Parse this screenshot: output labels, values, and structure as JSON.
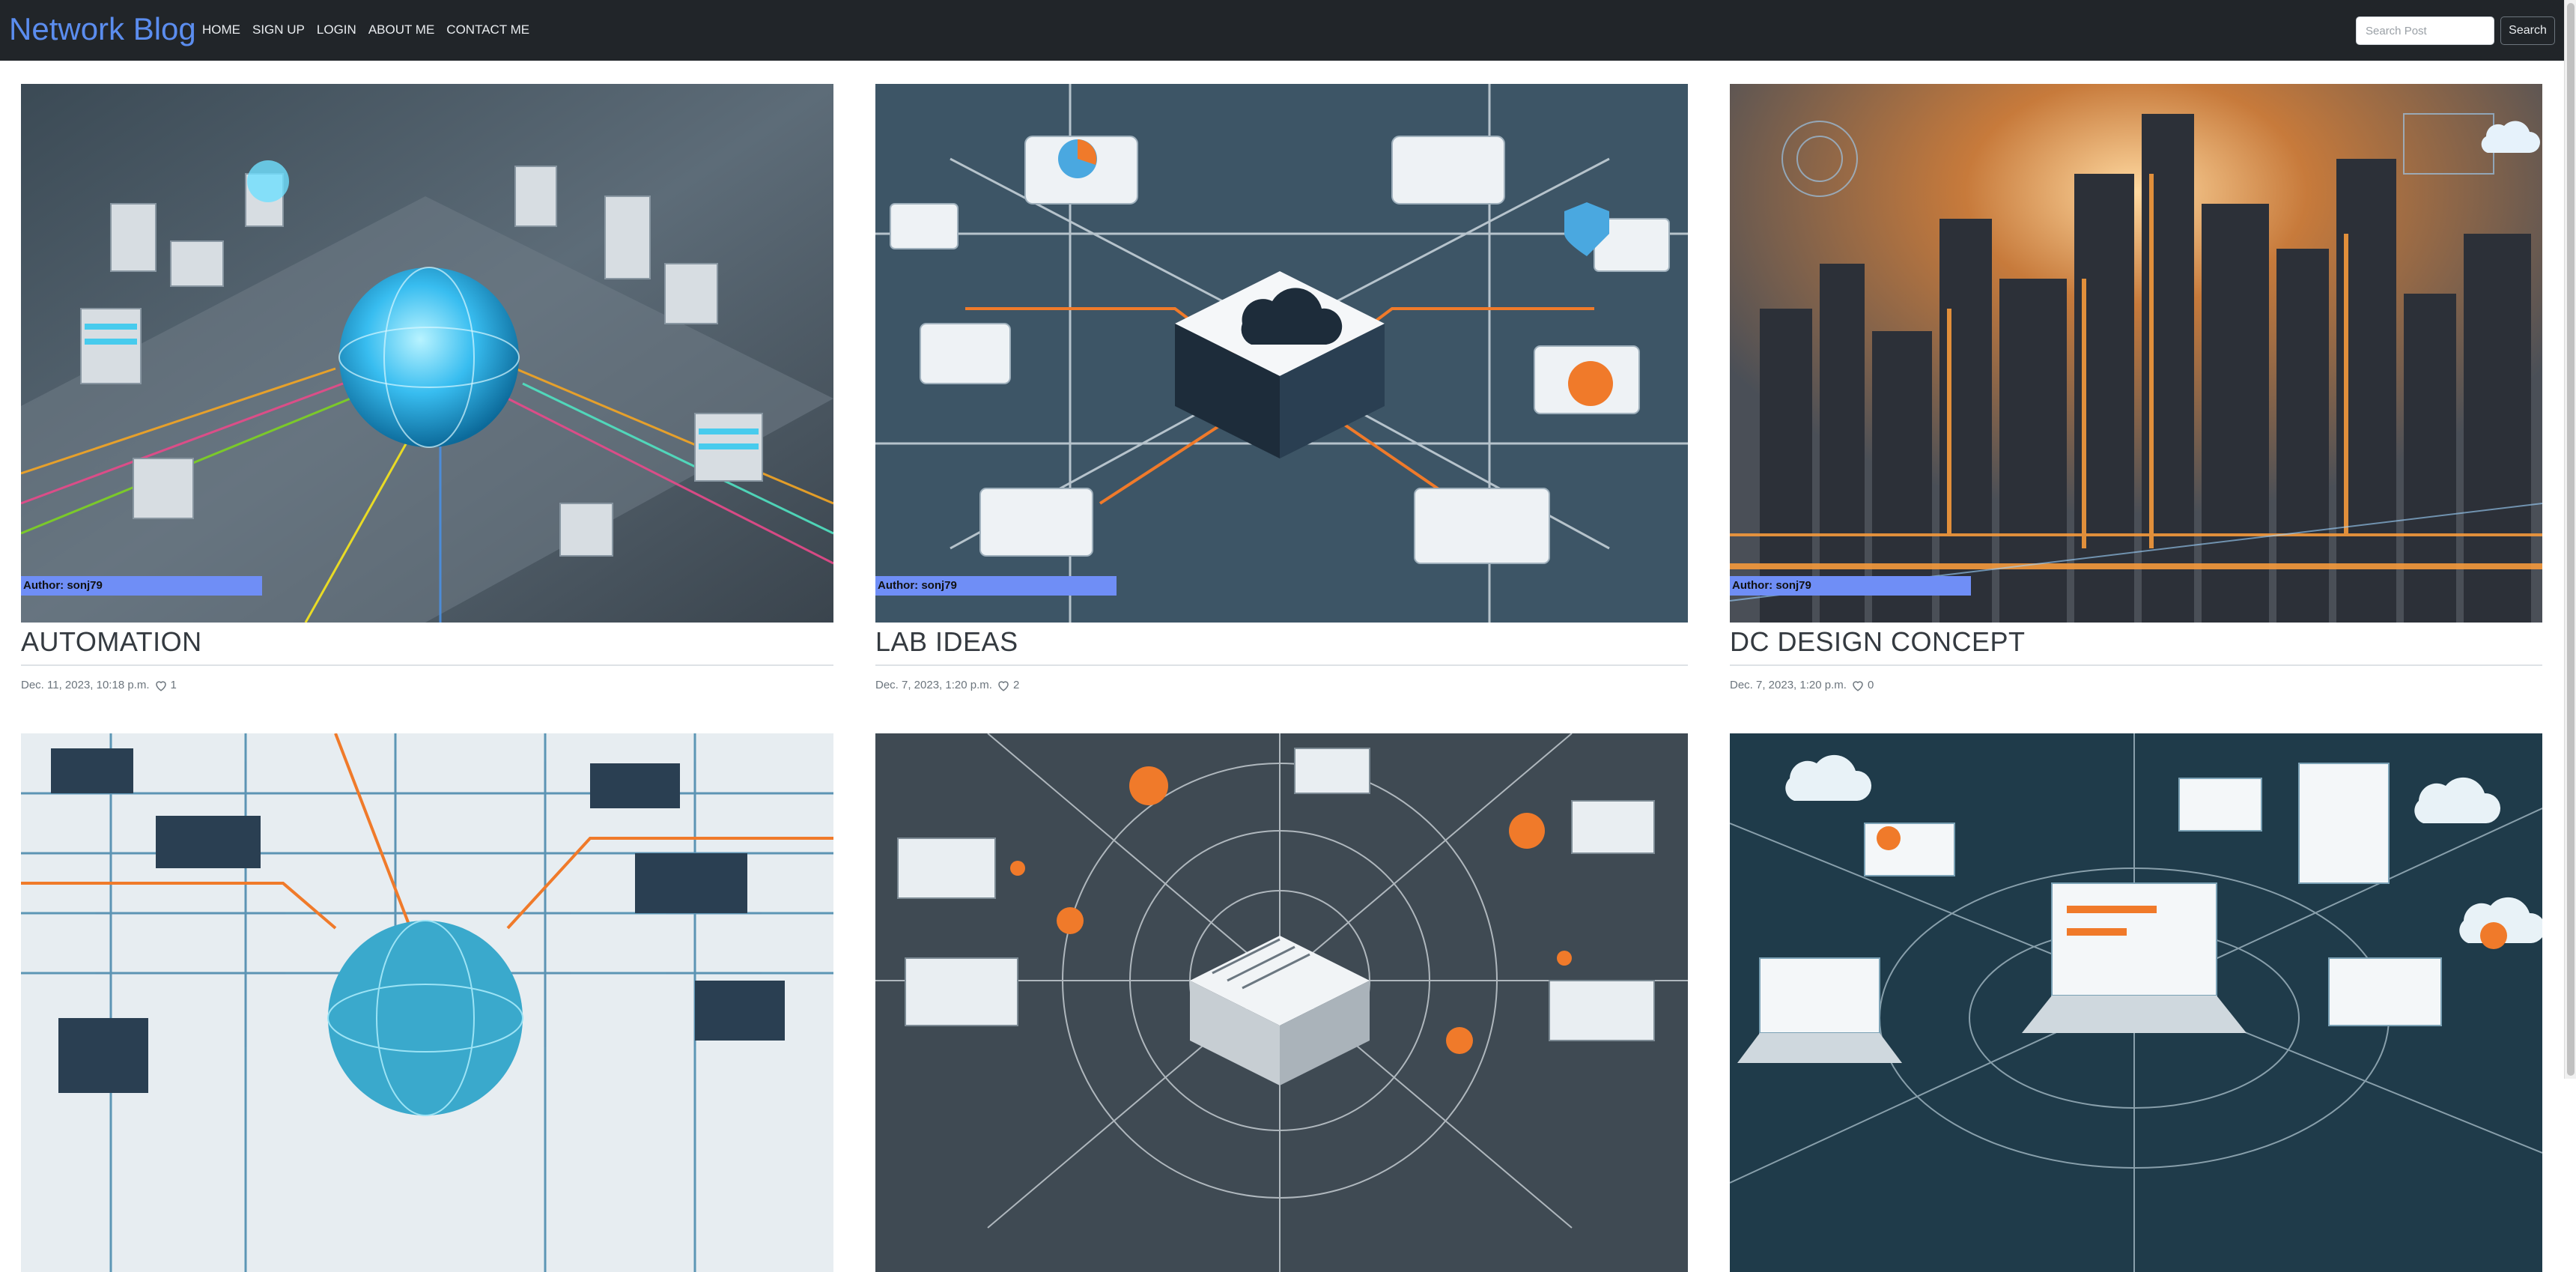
{
  "brand": "Network Blog",
  "nav": {
    "links": [
      "HOME",
      "SIGN UP",
      "LOGIN",
      "ABOUT ME",
      "CONTACT ME"
    ]
  },
  "search": {
    "placeholder": "Search Post",
    "button_label": "Search"
  },
  "posts": [
    {
      "author": "Author: sonj79",
      "title": "AUTOMATION",
      "date": "Dec. 11, 2023, 10:18 p.m.",
      "likes": "1",
      "image": "network-isometric-globe"
    },
    {
      "author": "Author: sonj79",
      "title": "LAB IDEAS",
      "date": "Dec. 7, 2023, 1:20 p.m.",
      "likes": "2",
      "image": "cloud-network-diagram"
    },
    {
      "author": "Author: sonj79",
      "title": "DC DESIGN CONCEPT",
      "date": "Dec. 7, 2023, 1:20 p.m.",
      "likes": "0",
      "image": "futuristic-city"
    },
    {
      "image": "circuit-globe"
    },
    {
      "image": "server-hub-diagram"
    },
    {
      "image": "laptop-network-diagram"
    }
  ],
  "colors": {
    "navbar": "#212529",
    "brand": "#5b8def",
    "author_badge": "#6f8ef6"
  }
}
